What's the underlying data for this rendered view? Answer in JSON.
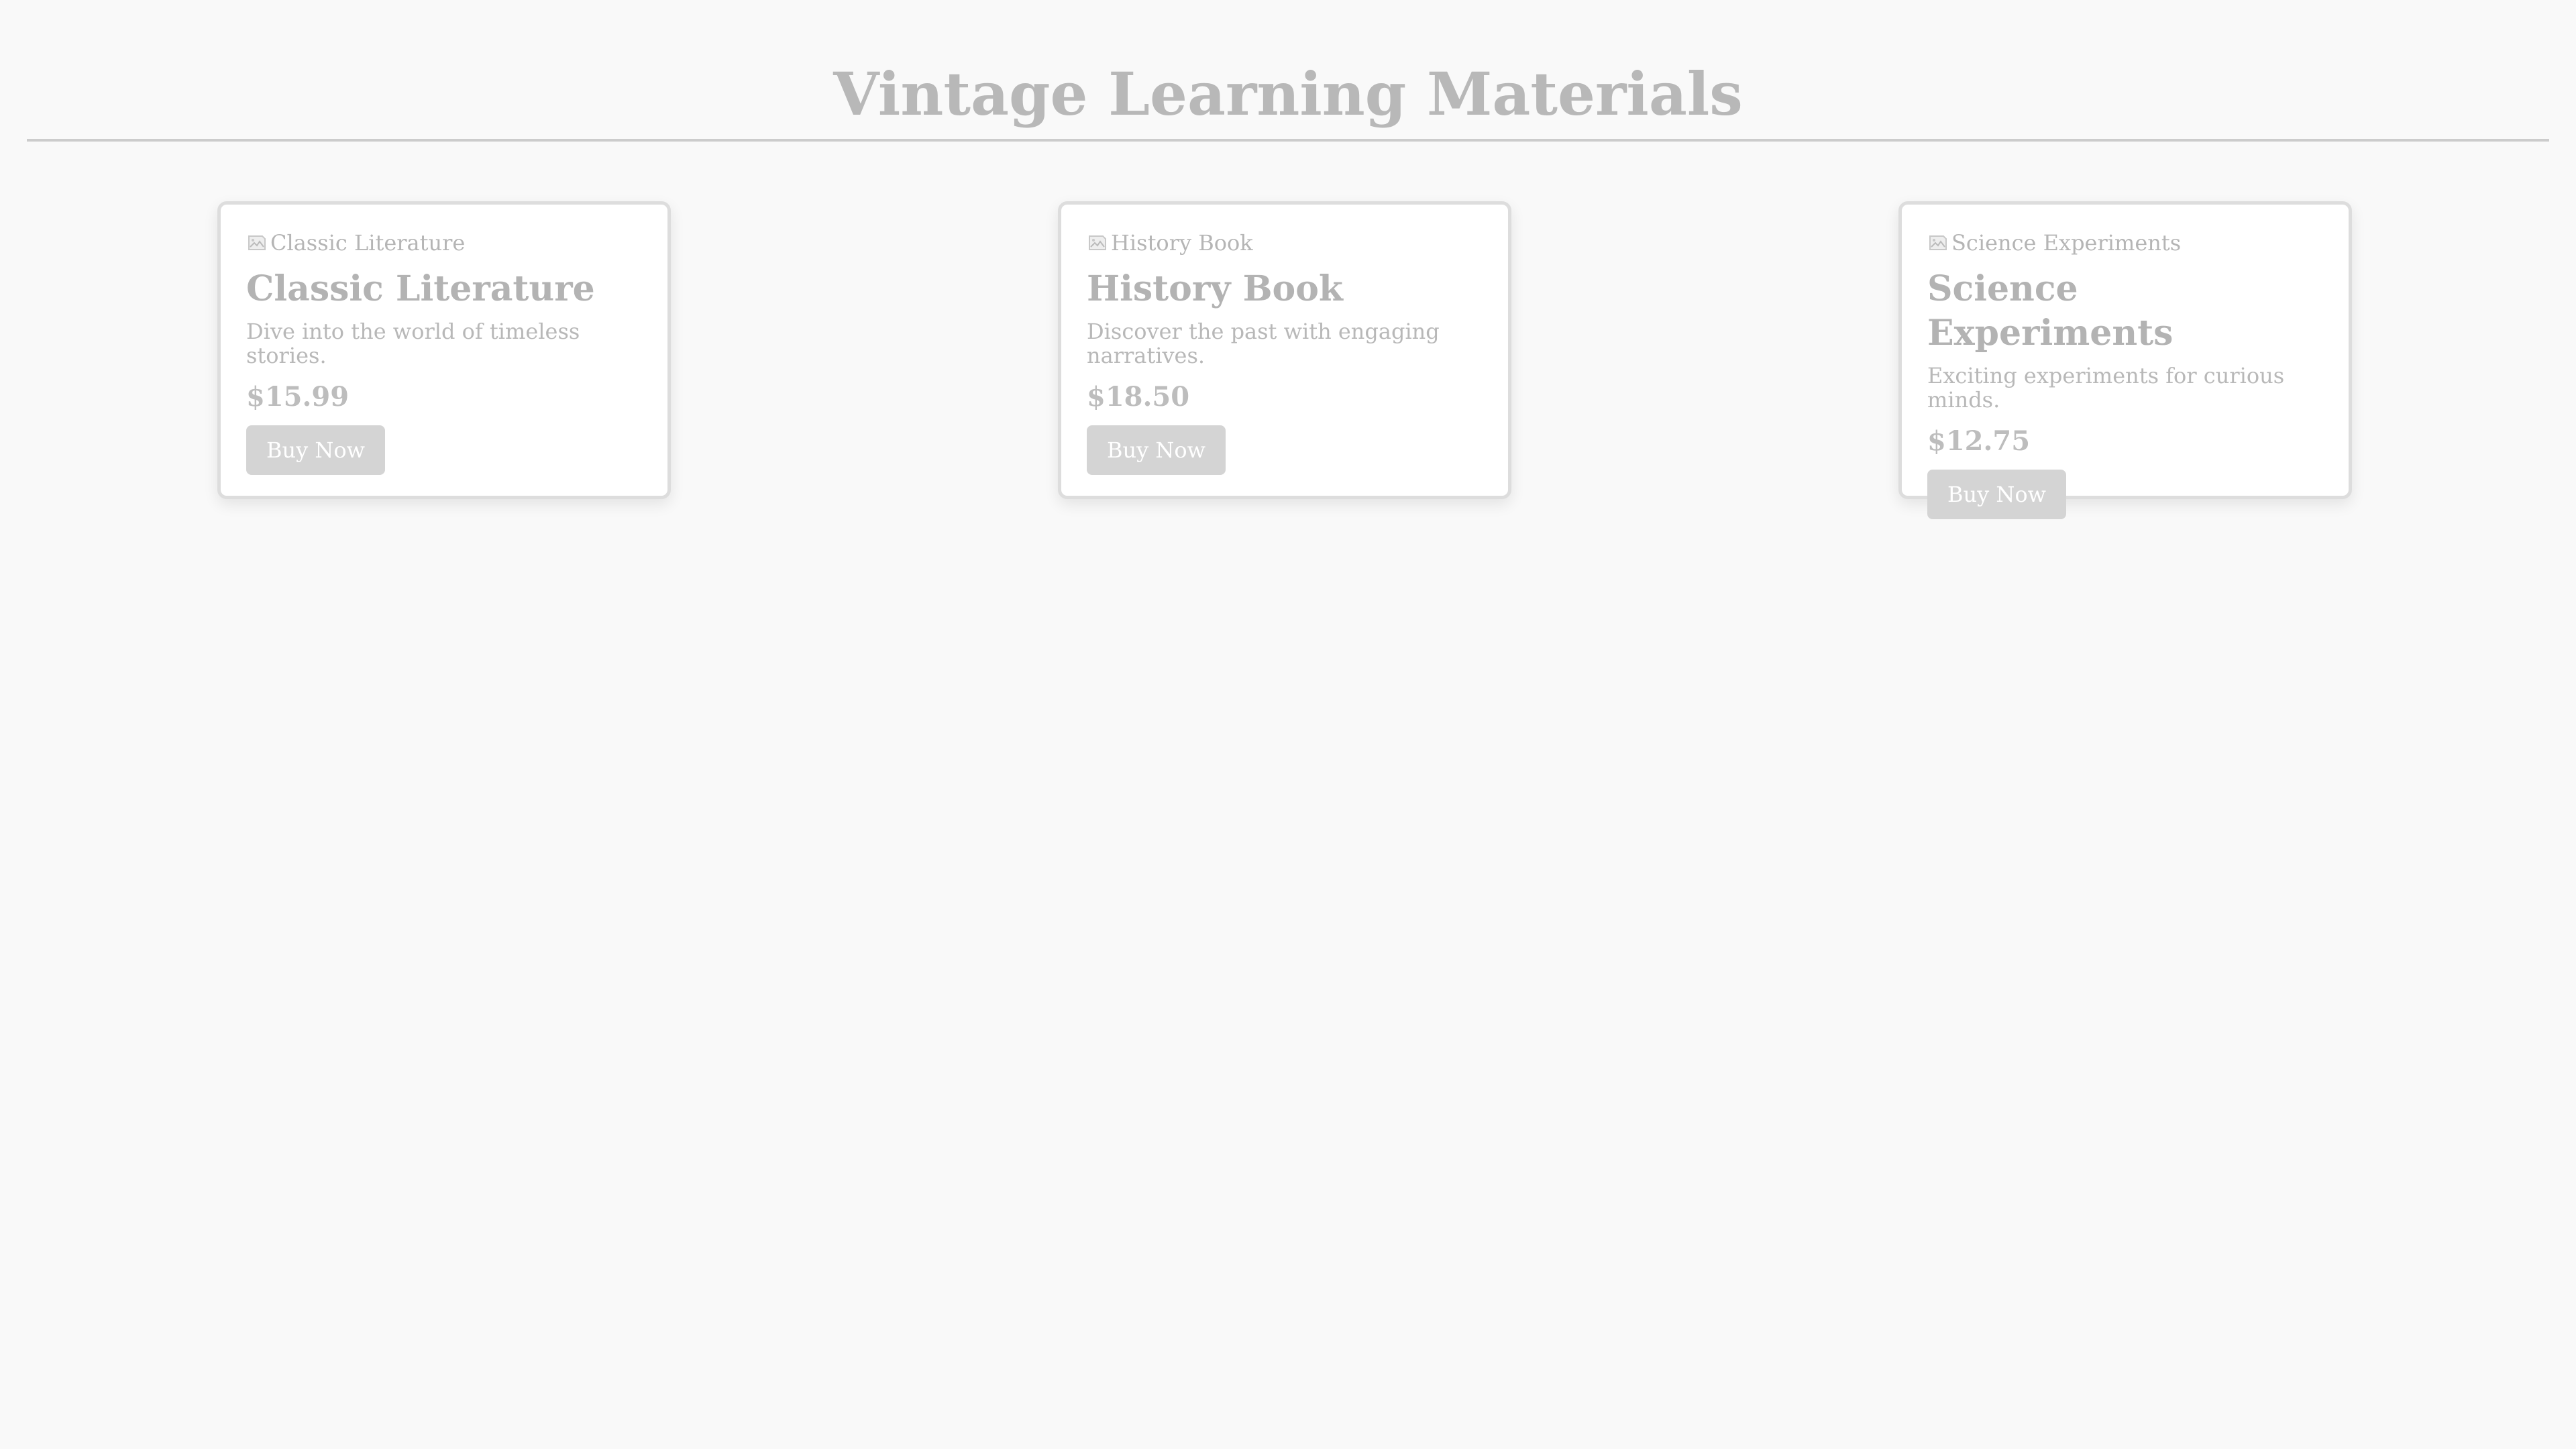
{
  "page": {
    "title": "Vintage Learning Materials"
  },
  "products": [
    {
      "image_alt": "Classic Literature",
      "title": "Classic Literature",
      "description": "Dive into the world of timeless stories.",
      "price": "$15.99",
      "button_label": "Buy Now"
    },
    {
      "image_alt": "History Book",
      "title": "History Book",
      "description": "Discover the past with engaging narratives.",
      "price": "$18.50",
      "button_label": "Buy Now"
    },
    {
      "image_alt": "Science Experiments",
      "title": "Science Experiments",
      "description": "Exciting experiments for curious minds.",
      "price": "$12.75",
      "button_label": "Buy Now"
    }
  ],
  "icons": {
    "image": "broken-image-icon"
  },
  "colors": {
    "background": "#f9f9f9",
    "card_background": "#ffffff",
    "button_background": "#d4d4d4",
    "button_text": "#ffffff",
    "divider": "#cccccc"
  }
}
